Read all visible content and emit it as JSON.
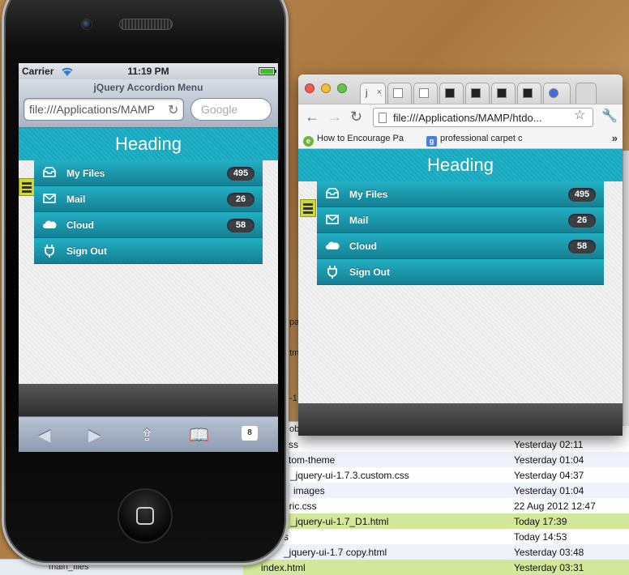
{
  "iphone": {
    "status": {
      "carrier": "Carrier",
      "time": "11:19 PM"
    },
    "safari": {
      "title": "jQuery Accordion Menu",
      "url": "file:///Applications/MAMP",
      "search_placeholder": "Google",
      "tabs_count": "8"
    }
  },
  "chrome": {
    "url": "file:///Applications/MAMP/htdo...",
    "tabs": [
      "j",
      "",
      "",
      "",
      "",
      "",
      "",
      ""
    ],
    "bookmarks": [
      "How to Encourage Pa",
      "professional carpet c"
    ]
  },
  "app": {
    "heading": "Heading",
    "menu": [
      {
        "label": "My Files",
        "count": "495",
        "icon": "inbox-icon"
      },
      {
        "label": "Mail",
        "count": "26",
        "icon": "mail-icon"
      },
      {
        "label": "Cloud",
        "count": "58",
        "icon": "cloud-icon"
      },
      {
        "label": "Sign Out",
        "count": "",
        "icon": "plug-icon"
      }
    ]
  },
  "finder": {
    "rows": [
      {
        "name": "css",
        "date": "Yesterday 02:11"
      },
      {
        "name": "stom-theme",
        "date": "Yesterday 01:04"
      },
      {
        "name": "_jquery-ui-1.7.3.custom.css",
        "date": "Yesterday 04:37"
      },
      {
        "name": "images",
        "date": "Yesterday 01:04"
      },
      {
        "name": "eric.css",
        "date": "22 Aug 2012 12:47"
      },
      {
        "name": "_jquery-ui-1.7_D1.html",
        "date": "Today 17:39"
      },
      {
        "name": "s",
        "date": "Today 14:53"
      },
      {
        "name": "_jquery-ui-1.7 copy.html",
        "date": "Yesterday 03:48"
      },
      {
        "name": "index.html",
        "date": "Yesterday 03:31"
      }
    ],
    "left_label": "main_files",
    "peek": [
      "pa",
      "tm",
      "-1",
      "ob"
    ]
  }
}
